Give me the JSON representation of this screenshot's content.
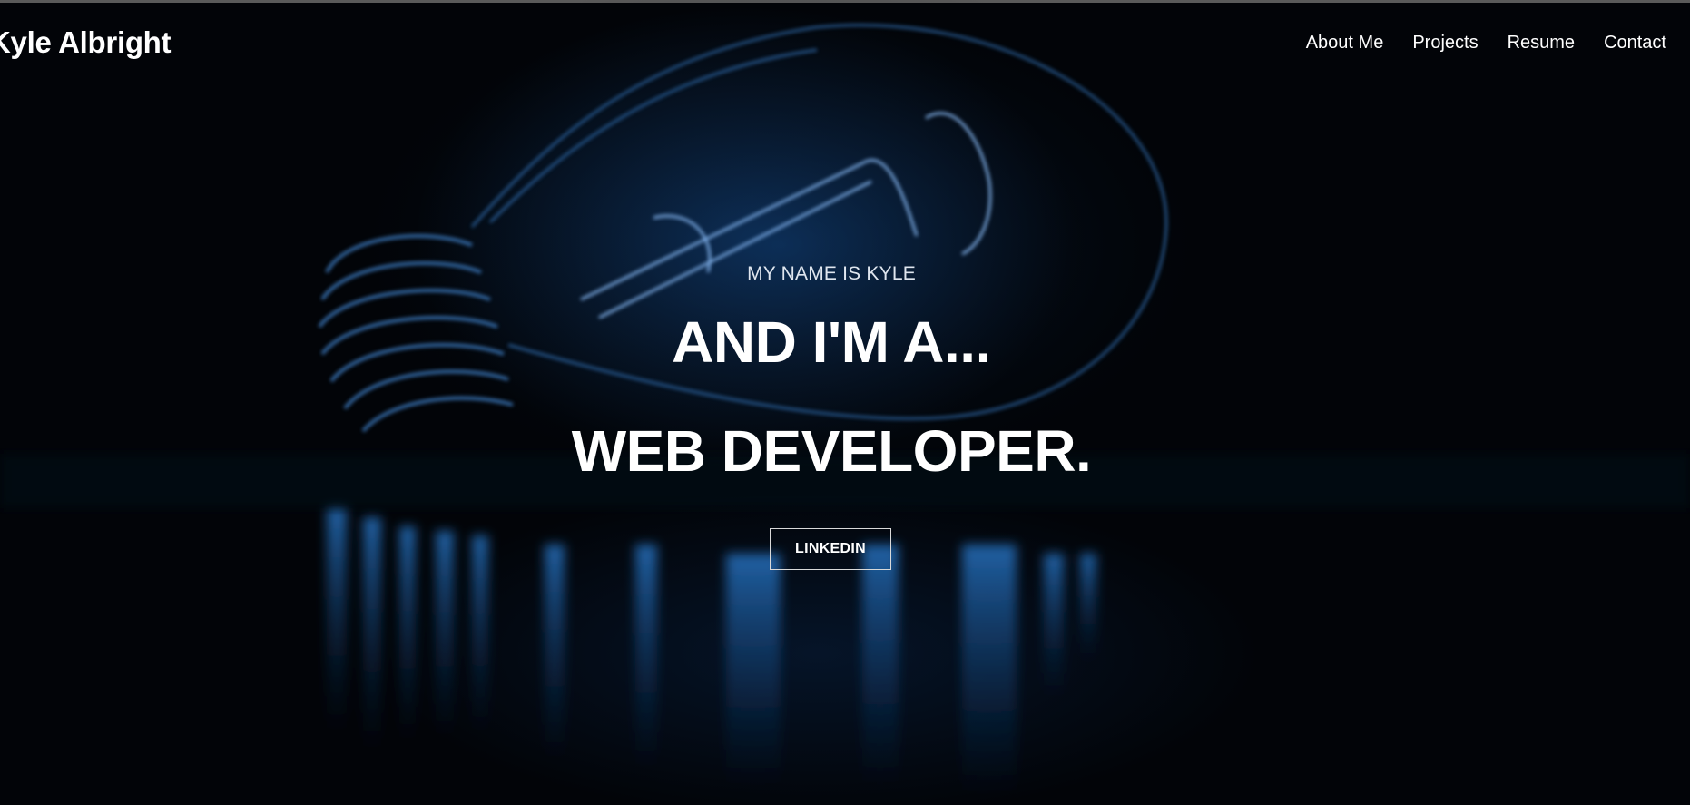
{
  "site": {
    "brand": "Kyle Albright"
  },
  "nav": {
    "items": [
      {
        "label": "About Me"
      },
      {
        "label": "Projects"
      },
      {
        "label": "Resume"
      },
      {
        "label": "Contact"
      }
    ]
  },
  "hero": {
    "kicker": "MY NAME IS KYLE",
    "headline": "AND I'M A...",
    "role": "WEB DEVELOPER.",
    "cta_label": "LINKEDIN",
    "background_image": "lightbulb-photo",
    "accent_color": "#1e6fc4",
    "background_color": "#000000"
  }
}
